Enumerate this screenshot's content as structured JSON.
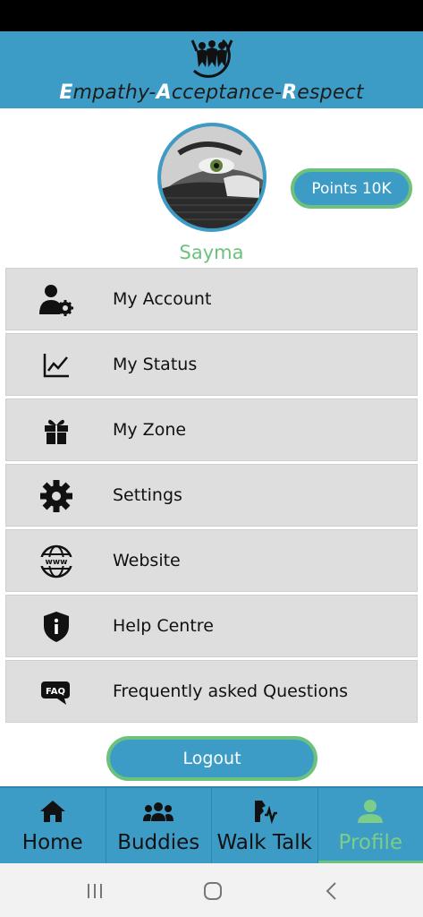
{
  "header": {
    "title_parts": [
      {
        "cap": "E",
        "rest": "mpathy-"
      },
      {
        "cap": "A",
        "rest": "cceptance-"
      },
      {
        "cap": "R",
        "rest": "espect"
      }
    ],
    "logo_icon": "people-hands-logo"
  },
  "profile": {
    "name": "Sayma",
    "points_label": "Points 10K",
    "avatar_icon": "user-photo"
  },
  "menu": {
    "items": [
      {
        "label": "My Account",
        "icon": "user-gear-icon"
      },
      {
        "label": "My Status",
        "icon": "line-chart-icon"
      },
      {
        "label": "My Zone",
        "icon": "gift-icon"
      },
      {
        "label": "Settings",
        "icon": "gear-icon"
      },
      {
        "label": "Website",
        "icon": "globe-www-icon"
      },
      {
        "label": "Help Centre",
        "icon": "shield-info-icon"
      },
      {
        "label": "Frequently asked Questions",
        "icon": "faq-icon"
      }
    ]
  },
  "actions": {
    "logout_label": "Logout"
  },
  "bottom_nav": {
    "tabs": [
      {
        "label": "Home",
        "icon": "home-icon"
      },
      {
        "label": "Buddies",
        "icon": "group-icon"
      },
      {
        "label": "Walk Talk",
        "icon": "walk-talk-icon"
      },
      {
        "label": "Profile",
        "icon": "person-icon",
        "active": true
      }
    ]
  },
  "colors": {
    "primary": "#3d9cc6",
    "accent_green": "#6cc27c",
    "menu_bg": "#dedede"
  }
}
